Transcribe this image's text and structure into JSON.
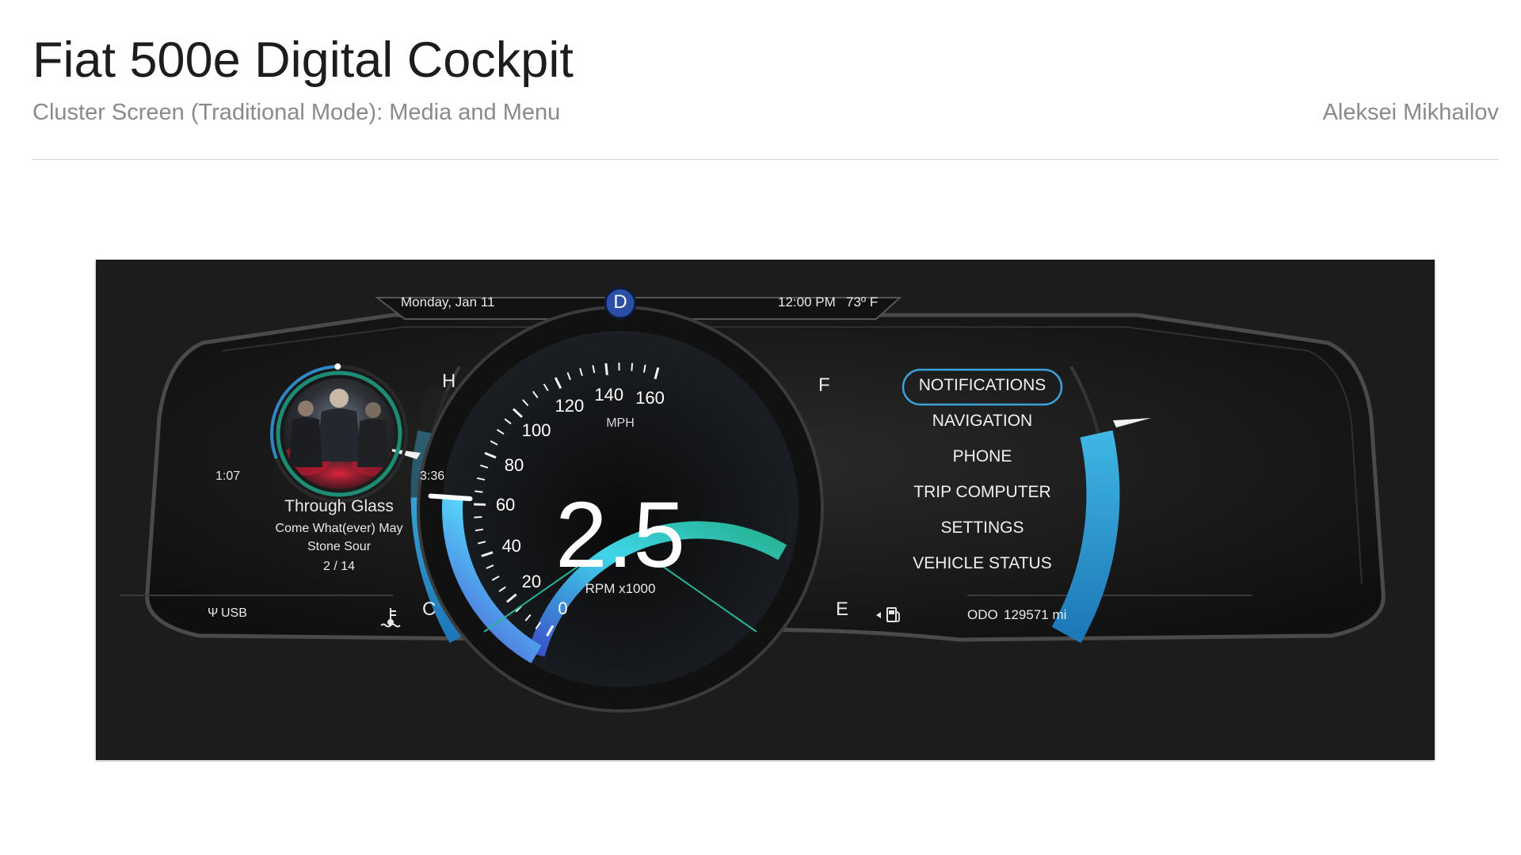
{
  "page": {
    "title": "Fiat 500e Digital Cockpit",
    "subtitle": "Cluster Screen (Traditional Mode): Media and Menu",
    "author": "Aleksei Mikhailov"
  },
  "cluster": {
    "date": "Monday, Jan 11",
    "time": "12:00 PM",
    "temperature": "73º F",
    "gear": "D",
    "media": {
      "elapsed": "1:07",
      "duration": "3:36",
      "progress": 0.31,
      "title": "Through Glass",
      "album": "Come What(ever) May",
      "artist": "Stone Sour",
      "track": "2 / 14",
      "source_icon": "usb-icon",
      "source": "USB"
    },
    "speedometer": {
      "unit": "MPH",
      "ticks": [
        "0",
        "20",
        "40",
        "60",
        "80",
        "100",
        "120",
        "140",
        "160"
      ],
      "speed": 62,
      "rpm_value": "2.5",
      "rpm_label": "RPM x1000"
    },
    "temp_gauge": {
      "high": "H",
      "low": "C",
      "level": 0.82,
      "icon": "coolant-temp-icon"
    },
    "fuel_gauge": {
      "full": "F",
      "empty": "E",
      "level": 0.7,
      "icon": "fuel-pump-icon"
    },
    "menu": {
      "items": [
        "NOTIFICATIONS",
        "NAVIGATION",
        "PHONE",
        "TRIP COMPUTER",
        "SETTINGS",
        "VEHICLE STATUS"
      ],
      "selected": "NOTIFICATIONS"
    },
    "odometer": {
      "label": "ODO",
      "value": "129571 mi"
    },
    "colors": {
      "accent": "#3fc6e6",
      "teal": "#23a58c",
      "gear_badge": "#2a4fa5",
      "background": "#1c1c1c"
    }
  }
}
